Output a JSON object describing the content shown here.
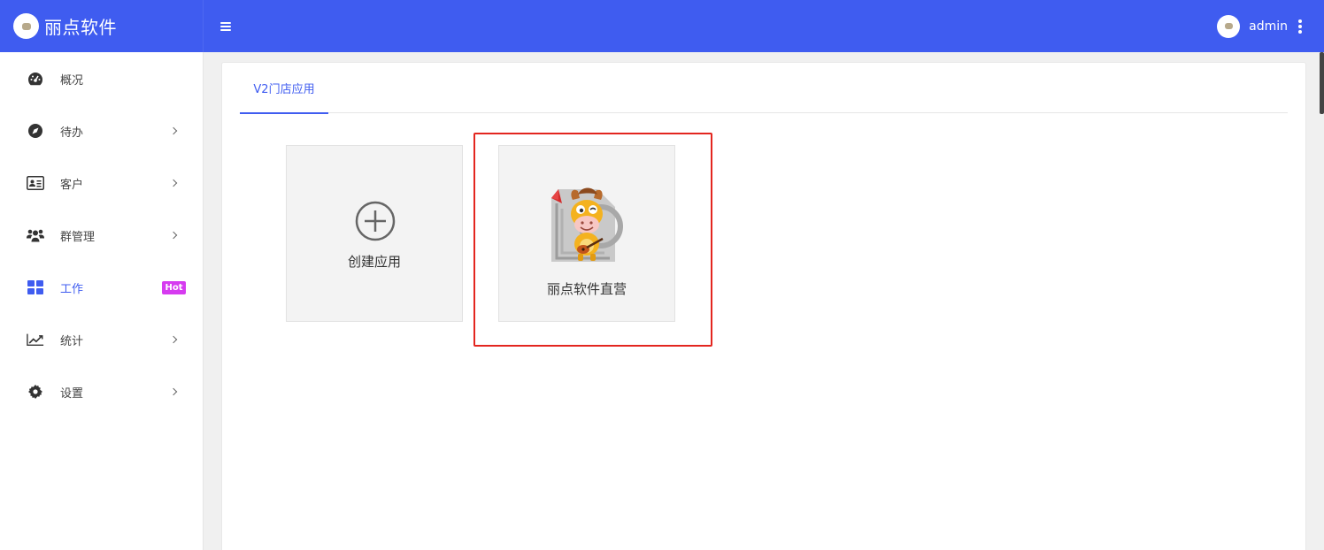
{
  "header": {
    "brand_name": "丽点软件",
    "logo_icon": "brand-logo-icon",
    "menu_icon": "hamburger-icon",
    "user_name": "admin",
    "more_icon": "kebab-menu-icon",
    "color": "#3f5cf0"
  },
  "sidebar": {
    "items": [
      {
        "label": "概况",
        "icon": "dashboard-gauge-icon",
        "has_arrow": false
      },
      {
        "label": "待办",
        "icon": "compass-icon",
        "has_arrow": true
      },
      {
        "label": "客户",
        "icon": "id-card-icon",
        "has_arrow": true
      },
      {
        "label": "群管理",
        "icon": "users-group-icon",
        "has_arrow": true
      },
      {
        "label": "工作",
        "icon": "grid-icon",
        "has_arrow": false,
        "active": true,
        "badge": "Hot"
      },
      {
        "label": "统计",
        "icon": "line-chart-icon",
        "has_arrow": true
      },
      {
        "label": "设置",
        "icon": "gear-icon",
        "has_arrow": true
      }
    ],
    "active_color": "#3f5cf0",
    "badge_color": "#d63bf0"
  },
  "main": {
    "tabs": [
      {
        "label": "V2门店应用",
        "active": true
      }
    ],
    "cards": [
      {
        "label": "创建应用",
        "icon": "plus-circle-icon"
      },
      {
        "label": "丽点软件直营",
        "icon": "cartoon-mascot-app-icon",
        "highlighted": true
      }
    ],
    "highlight_color": "#e3261f"
  }
}
